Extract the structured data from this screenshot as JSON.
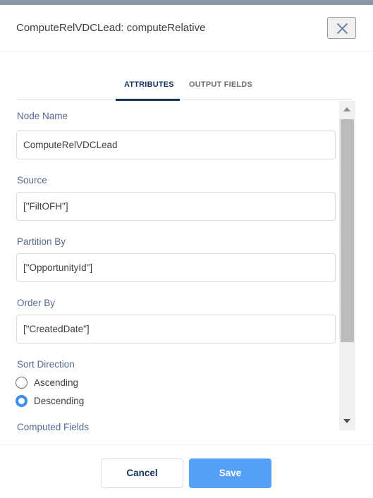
{
  "header": {
    "title": "ComputeRelVDCLead: computeRelative",
    "close_icon": "close-icon"
  },
  "tabs": [
    {
      "label": "ATTRIBUTES",
      "active": true
    },
    {
      "label": "OUTPUT FIELDS",
      "active": false
    }
  ],
  "fields": {
    "node_name": {
      "label": "Node Name",
      "value": "ComputeRelVDCLead"
    },
    "source": {
      "label": "Source",
      "value": "[\"FiltOFH\"]"
    },
    "partition_by": {
      "label": "Partition By",
      "value": "[\"OpportunityId\"]"
    },
    "order_by": {
      "label": "Order By",
      "value": "[\"CreatedDate\"]"
    },
    "sort_direction": {
      "label": "Sort Direction",
      "options": [
        {
          "label": "Ascending",
          "selected": false
        },
        {
          "label": "Descending",
          "selected": true
        }
      ]
    },
    "computed_fields": {
      "label": "Computed Fields"
    }
  },
  "footer": {
    "cancel_label": "Cancel",
    "save_label": "Save"
  },
  "colors": {
    "accent": "#56a0f7",
    "radio_checked": "#3b8ff0",
    "tab_active": "#16325c",
    "label": "#54698d"
  }
}
